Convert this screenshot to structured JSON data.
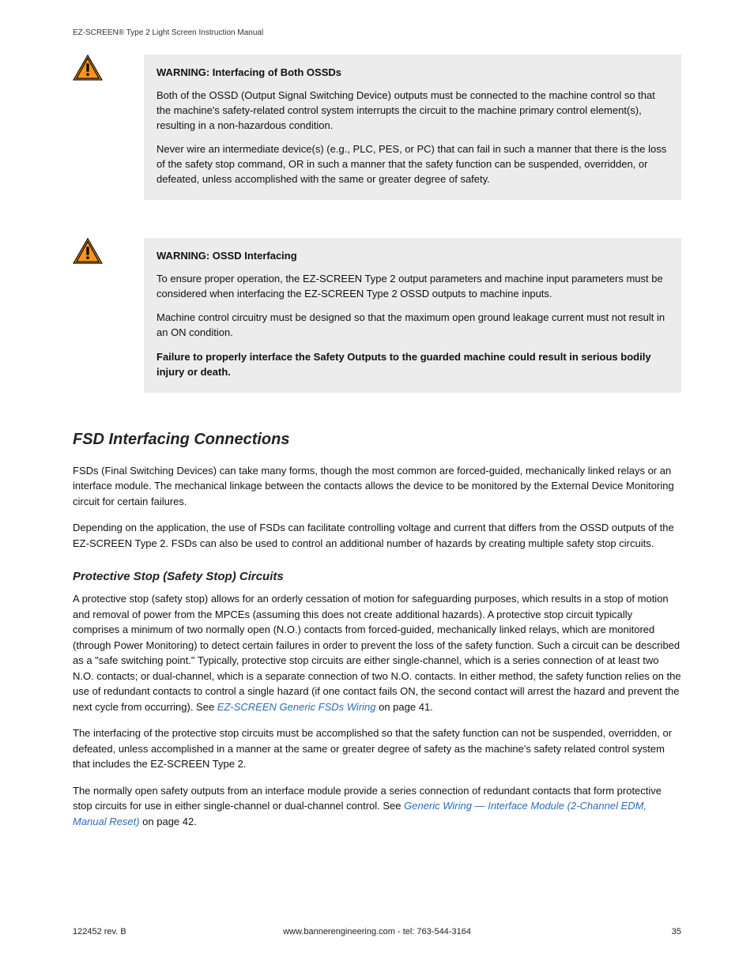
{
  "running_header": "EZ-SCREEN® Type 2 Light Screen Instruction Manual",
  "warnings": [
    {
      "title": "WARNING: Interfacing of Both OSSDs",
      "p1": "Both of the OSSD (Output Signal Switching Device) outputs must be connected to the machine control so that the machine's safety-related control system interrupts the circuit to the machine primary control element(s), resulting in a non-hazardous condition.",
      "p2": "Never wire an intermediate device(s) (e.g., PLC, PES, or PC) that can fail in such a manner that there is the loss of the safety stop command, OR in such a manner that the safety function can be suspended, overridden, or defeated, unless accomplished with the same or greater degree of safety."
    },
    {
      "title": "WARNING: OSSD Interfacing",
      "p1": "To ensure proper operation, the EZ-SCREEN Type 2 output parameters and machine input parameters must be considered when interfacing the EZ-SCREEN Type 2 OSSD outputs to machine inputs.",
      "p2": "Machine control circuitry must be designed so that the maximum open ground leakage current must not result in an ON condition.",
      "p3": "Failure to properly interface the Safety Outputs to the guarded machine could result in serious bodily injury or death."
    }
  ],
  "section_heading": "FSD Interfacing Connections",
  "section_p1": "FSDs (Final Switching Devices) can take many forms, though the most common are forced-guided, mechanically linked relays or an interface module. The mechanical linkage between the contacts allows the device to be monitored by the External Device Monitoring circuit for certain failures.",
  "section_p2": "Depending on the application, the use of FSDs can facilitate controlling voltage and current that differs from the OSSD outputs of the EZ-SCREEN Type 2. FSDs can also be used to control an additional number of hazards by creating multiple safety stop circuits.",
  "sub_heading": "Protective Stop (Safety Stop) Circuits",
  "sub_p1_a": "A protective stop (safety stop) allows for an orderly cessation of motion for safeguarding purposes, which results in a stop of motion and removal of power from the MPCEs (assuming this does not create additional hazards). A protective stop circuit typically comprises a minimum of two normally open (N.O.) contacts from forced-guided, mechanically linked relays, which are monitored (through Power Monitoring) to detect certain failures in order to prevent the loss of the safety function. Such a circuit can be described as a \"safe switching point.\" Typically, protective stop circuits are either single-channel, which is a series connection of at least two N.O. contacts; or dual-channel, which is a separate connection of two N.O. contacts. In either method, the safety function relies on the use of redundant contacts to control a single hazard (if one contact fails ON, the second contact will arrest the hazard and prevent the next cycle from occurring). See ",
  "sub_p1_link": "EZ-SCREEN Generic FSDs Wiring",
  "sub_p1_b": " on page 41.",
  "sub_p2": "The interfacing of the protective stop circuits must be accomplished so that the safety function can not be suspended, overridden, or defeated, unless accomplished in a manner at the same or greater degree of safety as the machine's safety related control system that includes the EZ-SCREEN Type 2.",
  "sub_p3_a": "The normally open safety outputs from an interface module provide a series connection of redundant contacts that form protective stop circuits for use in either single-channel or dual-channel control. See ",
  "sub_p3_link": "Generic Wiring — Interface Module (2-Channel EDM, Manual Reset)",
  "sub_p3_b": " on page 42.",
  "footer": {
    "left": "122452 rev. B",
    "center": "www.bannerengineering.com - tel: 763-544-3164",
    "right": "35"
  }
}
